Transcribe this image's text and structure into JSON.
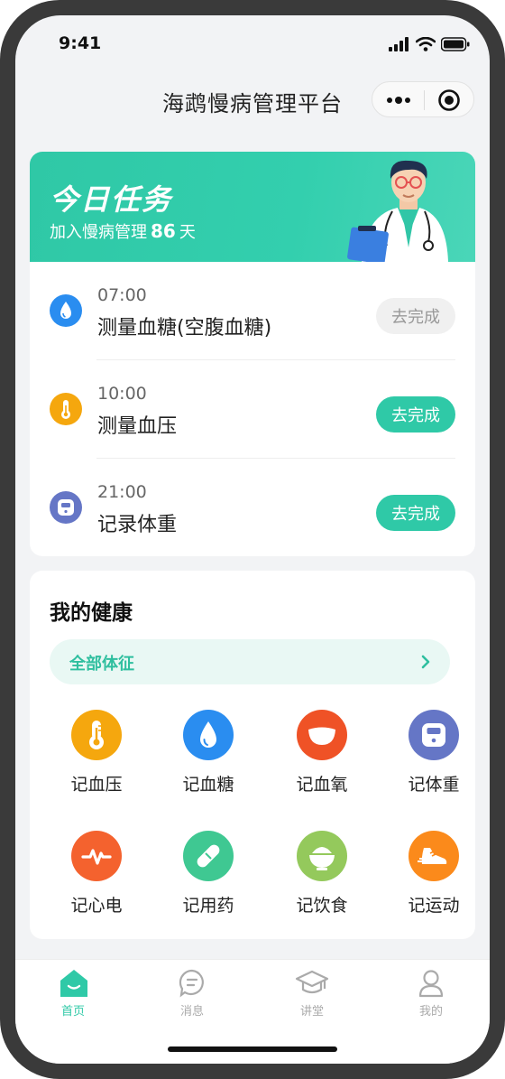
{
  "status_bar": {
    "time": "9:41"
  },
  "nav": {
    "title": "海鹉慢病管理平台"
  },
  "banner": {
    "title": "今日任务",
    "sub_prefix": "加入慢病管理",
    "days": "86",
    "sub_suffix": "天"
  },
  "tasks": [
    {
      "time": "07:00",
      "name": "测量血糖(空腹血糖)",
      "button": "去完成",
      "icon": "drop-icon",
      "color": "#2a8df0",
      "state": "disabled"
    },
    {
      "time": "10:00",
      "name": "测量血压",
      "button": "去完成",
      "icon": "thermometer-icon",
      "color": "#f5a70e",
      "state": "active"
    },
    {
      "time": "21:00",
      "name": "记录体重",
      "button": "去完成",
      "icon": "scale-icon",
      "color": "#6576c6",
      "state": "active"
    }
  ],
  "health": {
    "title": "我的健康",
    "all_signs": "全部体征",
    "items": [
      {
        "label": "记血压",
        "icon": "thermometer-icon",
        "color": "#f5a70e"
      },
      {
        "label": "记血糖",
        "icon": "drop-icon",
        "color": "#2a8df0"
      },
      {
        "label": "记血氧",
        "icon": "lung-icon",
        "color": "#ef5226"
      },
      {
        "label": "记体重",
        "icon": "scale-icon",
        "color": "#6576c6"
      },
      {
        "label": "记心电",
        "icon": "heartbeat-icon",
        "color": "#f4622e"
      },
      {
        "label": "记用药",
        "icon": "pill-icon",
        "color": "#3fc892"
      },
      {
        "label": "记饮食",
        "icon": "bowl-icon",
        "color": "#94c95c"
      },
      {
        "label": "记运动",
        "icon": "sneaker-icon",
        "color": "#fb8a1b"
      }
    ]
  },
  "tabbar": [
    {
      "label": "首页",
      "icon": "home-icon",
      "active": true
    },
    {
      "label": "消息",
      "icon": "message-icon",
      "active": false
    },
    {
      "label": "讲堂",
      "icon": "graduation-cap-icon",
      "active": false
    },
    {
      "label": "我的",
      "icon": "user-icon",
      "active": false
    }
  ],
  "colors": {
    "primary": "#2fc9a7",
    "background": "#f2f3f5"
  }
}
